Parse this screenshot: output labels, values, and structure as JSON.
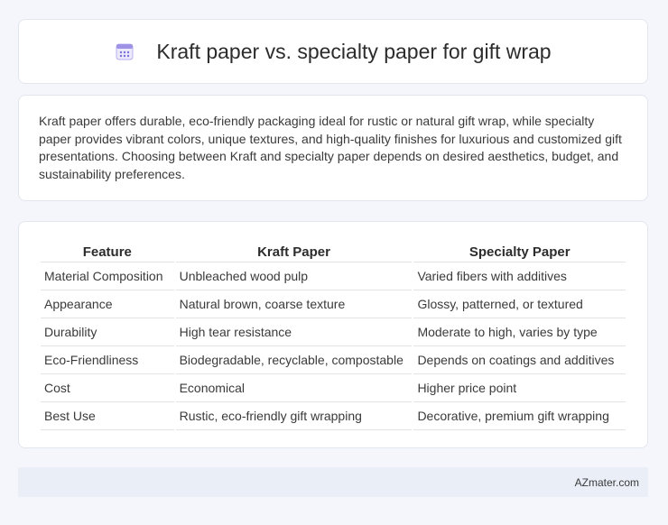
{
  "header": {
    "title": "Kraft paper vs. specialty paper for gift wrap",
    "icon": "calendar-icon"
  },
  "description": "Kraft paper offers durable, eco-friendly packaging ideal for rustic or natural gift wrap, while specialty paper provides vibrant colors, unique textures, and high-quality finishes for luxurious and customized gift presentations. Choosing between Kraft and specialty paper depends on desired aesthetics, budget, and sustainability preferences.",
  "table": {
    "columns": [
      "Feature",
      "Kraft Paper",
      "Specialty Paper"
    ],
    "rows": [
      [
        "Material Composition",
        "Unbleached wood pulp",
        "Varied fibers with additives"
      ],
      [
        "Appearance",
        "Natural brown, coarse texture",
        "Glossy, patterned, or textured"
      ],
      [
        "Durability",
        "High tear resistance",
        "Moderate to high, varies by type"
      ],
      [
        "Eco-Friendliness",
        "Biodegradable, recyclable, compostable",
        "Depends on coatings and additives"
      ],
      [
        "Cost",
        "Economical",
        "Higher price point"
      ],
      [
        "Best Use",
        "Rustic, eco-friendly gift wrapping",
        "Decorative, premium gift wrapping"
      ]
    ]
  },
  "footer": {
    "brand": "AZmater.com"
  },
  "colors": {
    "background": "#f4f6fb",
    "card": "#ffffff",
    "footer": "#e9eef7",
    "icon_accent": "#7b6fd6"
  }
}
